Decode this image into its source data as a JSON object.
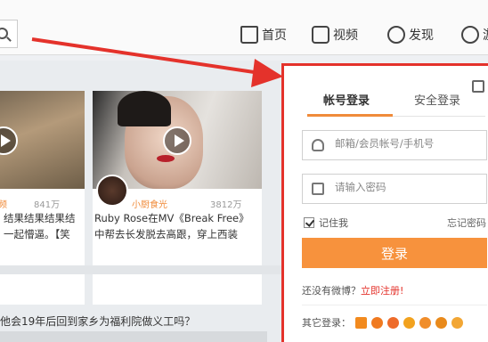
{
  "nav": {
    "items": [
      {
        "label": "首页",
        "icon": "home-icon"
      },
      {
        "label": "视频",
        "icon": "video-icon"
      },
      {
        "label": "发现",
        "icon": "discover-icon"
      },
      {
        "label": "游",
        "icon": "cloud-icon"
      }
    ]
  },
  "feed": {
    "card1": {
      "count_left": "频",
      "count_right": "841万",
      "title_line1": "结果结果结果结",
      "title_line2": "一起懵逼。【笑"
    },
    "card2": {
      "author": "小厨食光",
      "count": "3812万",
      "title_line1": "Ruby Rose在MV《Break Free》",
      "title_line2": "中帮去长发脱去高跟，穿上西装"
    },
    "bottom_text": "他会19年后回到家乡为福利院做义工吗？"
  },
  "login": {
    "tab_account": "帐号登录",
    "tab_secure": "安全登录",
    "username_placeholder": "邮箱/会员帐号/手机号",
    "password_placeholder": "请输入密码",
    "remember_label": "记住我",
    "forgot_label": "忘记密码",
    "login_button": "登录",
    "no_account_text": "还没有微博？",
    "register_link": "立即注册!",
    "other_login_label": "其它登录：",
    "other_icons": [
      "qq-icon",
      "tencent-icon",
      "weibo-icon",
      "tmall-icon",
      "baidu-icon",
      "paw-icon",
      "feather-icon"
    ],
    "other_icon_colors": [
      "#f28a1e",
      "#f07a20",
      "#ee6b2a",
      "#f2a21e",
      "#f08d2a",
      "#e98a1b",
      "#f2a634"
    ]
  },
  "colors": {
    "accent": "#f7923d",
    "highlight_border": "#e4322b"
  }
}
